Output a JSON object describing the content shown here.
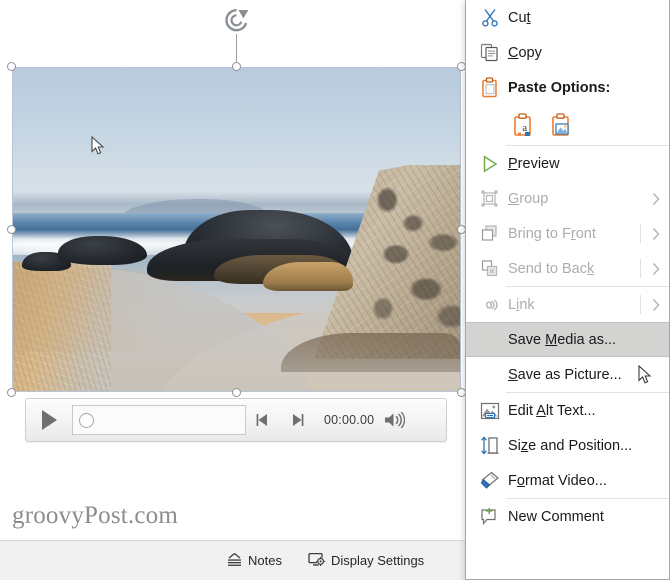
{
  "app": {
    "kind": "powerpoint-slide-editor",
    "watermark": "groovyPost.com"
  },
  "colors": {
    "menu_bg": "#ffffff",
    "menu_border": "#a6a6a6",
    "menu_highlight": "#d3d3d1",
    "disabled_text": "#adadad",
    "accent_orange": "#ed7d31",
    "accent_blue": "#2e75b6",
    "accent_green": "#70ad47",
    "status_bar_bg": "#f1f1f1",
    "handle_stroke": "#8f9499"
  },
  "selection": {
    "object_type": "video-placeholder",
    "rotate_handle_icon": "rotate-icon",
    "handles": [
      "handle-top-left",
      "handle-top-center",
      "handle-top-right",
      "handle-middle-left",
      "handle-middle-right",
      "handle-bottom-left",
      "handle-bottom-center",
      "handle-bottom-right"
    ]
  },
  "media_controls": {
    "play_icon": "play-icon",
    "seek_thumb_icon": "seek-thumb",
    "prev_frame_icon": "previous-frame-icon",
    "next_frame_icon": "next-frame-icon",
    "time": "00:00.00",
    "volume_icon": "volume-icon"
  },
  "status_bar": {
    "items": [
      {
        "label": "Notes",
        "icon": "notes-icon"
      },
      {
        "label": "Display Settings",
        "icon": "display-settings-icon"
      }
    ]
  },
  "context_menu": {
    "items": [
      {
        "label": "Cut",
        "icon": "scissors-icon",
        "type": "item",
        "disabled": false,
        "bold": false,
        "submenu": false,
        "selected": false,
        "accesskey_index": 2
      },
      {
        "label": "Copy",
        "icon": "copy-icon",
        "type": "item",
        "disabled": false,
        "bold": false,
        "submenu": false,
        "selected": false,
        "accesskey_index": 0
      },
      {
        "label": "Paste Options:",
        "icon": "clipboard-icon",
        "type": "header",
        "disabled": false,
        "bold": true,
        "submenu": false,
        "selected": false
      },
      {
        "label": "",
        "type": "paste-options",
        "options": [
          {
            "name": "keep-text-only-icon",
            "tooltip": "Keep Text Only"
          },
          {
            "name": "picture-icon",
            "tooltip": "Picture"
          }
        ]
      },
      {
        "type": "separator"
      },
      {
        "label": "Preview",
        "icon": "preview-play-icon",
        "type": "item",
        "disabled": false,
        "bold": false,
        "submenu": false,
        "selected": false,
        "accesskey_index": 0
      },
      {
        "label": "Group",
        "icon": "group-icon",
        "type": "item",
        "disabled": true,
        "bold": false,
        "submenu": true,
        "selected": false,
        "accesskey_index": 0
      },
      {
        "label": "Bring to Front",
        "icon": "bring-to-front-icon",
        "type": "item",
        "disabled": true,
        "bold": false,
        "submenu": true,
        "selected": false,
        "accesskey_index": 11
      },
      {
        "label": "Send to Back",
        "icon": "send-to-back-icon",
        "type": "item",
        "disabled": true,
        "bold": false,
        "submenu": true,
        "selected": false,
        "accesskey_index": 11
      },
      {
        "type": "separator"
      },
      {
        "label": "Link",
        "icon": "link-icon",
        "type": "item",
        "disabled": true,
        "bold": false,
        "submenu": true,
        "selected": false,
        "accesskey_index": 1
      },
      {
        "label": "Save Media as...",
        "icon": null,
        "type": "item",
        "disabled": false,
        "bold": false,
        "submenu": false,
        "selected": true,
        "accesskey_index": 5
      },
      {
        "label": "Save as Picture...",
        "icon": null,
        "type": "item",
        "disabled": false,
        "bold": false,
        "submenu": false,
        "selected": false,
        "accesskey_index": 0
      },
      {
        "type": "separator"
      },
      {
        "label": "Edit Alt Text...",
        "icon": "alt-text-icon",
        "type": "item",
        "disabled": false,
        "bold": false,
        "submenu": false,
        "selected": false,
        "accesskey_index": 5
      },
      {
        "label": "Size and Position...",
        "icon": "size-position-icon",
        "type": "item",
        "disabled": false,
        "bold": false,
        "submenu": false,
        "selected": false,
        "accesskey_index": 2
      },
      {
        "label": "Format Video...",
        "icon": "format-video-icon",
        "type": "item",
        "disabled": false,
        "bold": false,
        "submenu": false,
        "selected": false,
        "accesskey_index": 1
      },
      {
        "type": "separator"
      },
      {
        "label": "New Comment",
        "icon": "new-comment-icon",
        "type": "item",
        "disabled": false,
        "bold": false,
        "submenu": false,
        "selected": false
      }
    ]
  }
}
